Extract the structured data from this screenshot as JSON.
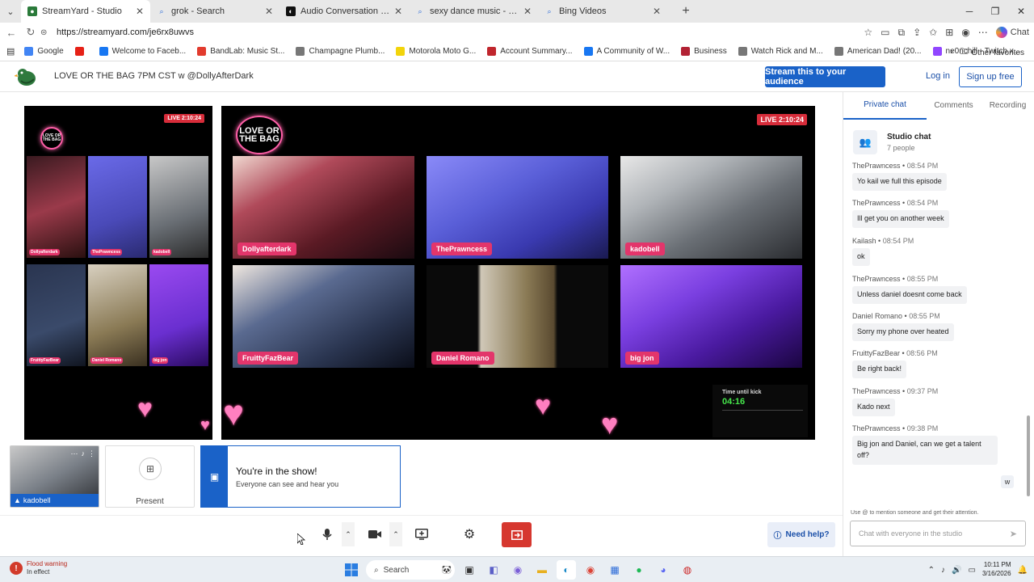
{
  "browser": {
    "tabs": [
      {
        "label": "StreamYard - Studio",
        "active": true,
        "icon": "streamyard-favicon"
      },
      {
        "label": "grok - Search",
        "active": false,
        "icon": "search-icon"
      },
      {
        "label": "Audio Conversation - Grok",
        "active": false,
        "icon": "grok-favicon"
      },
      {
        "label": "sexy dance music - Search",
        "active": false,
        "icon": "search-icon"
      },
      {
        "label": "Bing Videos",
        "active": false,
        "icon": "search-icon"
      }
    ],
    "url": "https://streamyard.com/je6rx8uwvs",
    "chat_label": "Chat",
    "bookmarks": [
      {
        "label": "Google",
        "color": "#4285f4"
      },
      {
        "label": "",
        "color": "#e62117"
      },
      {
        "label": "Welcome to Faceb...",
        "color": "#1877f2"
      },
      {
        "label": "BandLab: Music St...",
        "color": "#e23b2e"
      },
      {
        "label": "Champagne Plumb...",
        "color": "#777777"
      },
      {
        "label": "Motorola Moto G...",
        "color": "#f2d40b"
      },
      {
        "label": "Account Summary...",
        "color": "#c0262d"
      },
      {
        "label": "A Community of W...",
        "color": "#1877f2"
      },
      {
        "label": "Business",
        "color": "#b22234"
      },
      {
        "label": "Watch Rick and M...",
        "color": "#777777"
      },
      {
        "label": "American Dad! (20...",
        "color": "#777777"
      },
      {
        "label": "ne0nchill - Twitch x...",
        "color": "#9146ff"
      }
    ],
    "other_favorites": "Other favorites"
  },
  "header": {
    "title": "LOVE OR THE BAG 7PM CST w @DollyAfterDark",
    "stream_button": "Stream this to your audience",
    "login": "Log in",
    "signup": "Sign up free"
  },
  "stage": {
    "live_label": "LIVE 2:10:24",
    "logo_text": "LOVE OR THE BAG",
    "kick_label": "Time until kick",
    "kick_value": "04:16",
    "participants": [
      {
        "name": "Dollyafterdark",
        "bg": "#7a2f3a"
      },
      {
        "name": "ThePrawncess",
        "bg": "#5a5fd8"
      },
      {
        "name": "kadobell",
        "bg": "#8a8f95"
      },
      {
        "name": "FruittyFazBear",
        "bg": "#3a4a6a"
      },
      {
        "name": "Daniel Romano",
        "bg": "#8a7a55"
      },
      {
        "name": "big jon",
        "bg": "#6a2fd0"
      }
    ]
  },
  "tray": {
    "self_name": "kadobell",
    "present_label": "Present",
    "in_show_title": "You're in the show!",
    "in_show_sub": "Everyone can see and hear you",
    "need_help": "Need help?"
  },
  "sidebar": {
    "tabs": [
      "Private chat",
      "Comments",
      "Recording"
    ],
    "studio_chat_title": "Studio chat",
    "studio_chat_people": "7 people",
    "messages": [
      {
        "author": "ThePrawncess",
        "time": "08:54 PM",
        "text": "Yo kail we full this episode"
      },
      {
        "author": "ThePrawncess",
        "time": "08:54 PM",
        "text": "Ill get you on another week"
      },
      {
        "author": "Kailash",
        "time": "08:54 PM",
        "text": "ok"
      },
      {
        "author": "ThePrawncess",
        "time": "08:55 PM",
        "text": "Unless daniel doesnt come back"
      },
      {
        "author": "Daniel Romano",
        "time": "08:55 PM",
        "text": "Sorry my phone over heated"
      },
      {
        "author": "FruittyFazBear",
        "time": "08:56 PM",
        "text": "Be right back!"
      },
      {
        "author": "ThePrawncess",
        "time": "09:37 PM",
        "text": "Kado next"
      },
      {
        "author": "ThePrawncess",
        "time": "09:38 PM",
        "text": "Big jon and Daniel, can we get a talent off?"
      }
    ],
    "self_bubble": "w",
    "mention_hint": "Use @ to mention someone and get their attention.",
    "input_placeholder": "Chat with everyone in the studio"
  },
  "taskbar": {
    "weather_title": "Flood warning",
    "weather_sub": "In effect",
    "search_label": "Search",
    "time": "10:11 PM",
    "date": "3/16/2026"
  }
}
